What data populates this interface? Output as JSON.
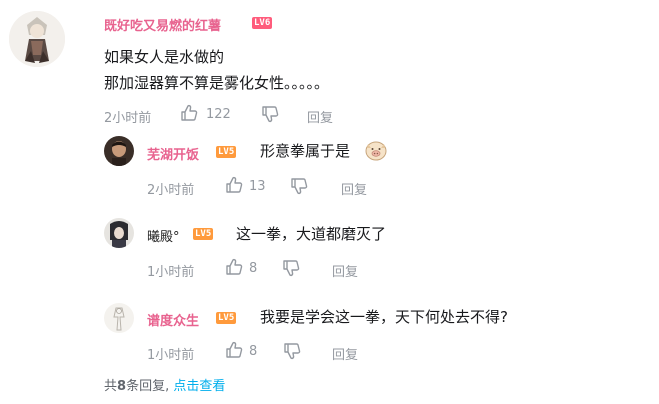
{
  "root_comment": {
    "username": "既好吃又易燃的红薯",
    "level": "LV6",
    "lines": [
      "如果女人是水做的",
      "那加湿器算不算是雾化女性。。。。。"
    ],
    "time": "2小时前",
    "likes": "122",
    "reply_label": "回复"
  },
  "replies": [
    {
      "username": "芜湖开饭",
      "level": "LV5",
      "text": "形意拳属于是",
      "time": "2小时前",
      "likes": "13",
      "reply_label": "回复",
      "emoji": "pig-face-emoji"
    },
    {
      "username": "曦殿°",
      "level": "LV5",
      "text": "这一拳，大道都磨灭了",
      "time": "1小时前",
      "likes": "8",
      "reply_label": "回复"
    },
    {
      "username": "谱度众生",
      "level": "LV5",
      "text": "我要是学会这一拳，天下何处去不得?",
      "time": "1小时前",
      "likes": "8",
      "reply_label": "回复"
    }
  ],
  "footer": {
    "prefix": "共",
    "count": "8",
    "suffix": "条回复,",
    "link": "点击查看"
  },
  "colors": {
    "username_pink": "#e8638f",
    "meta_gray": "#9499a0",
    "link_blue": "#00aeec",
    "lv6": "#ff5c7c",
    "lv5": "#ff9a3c"
  }
}
